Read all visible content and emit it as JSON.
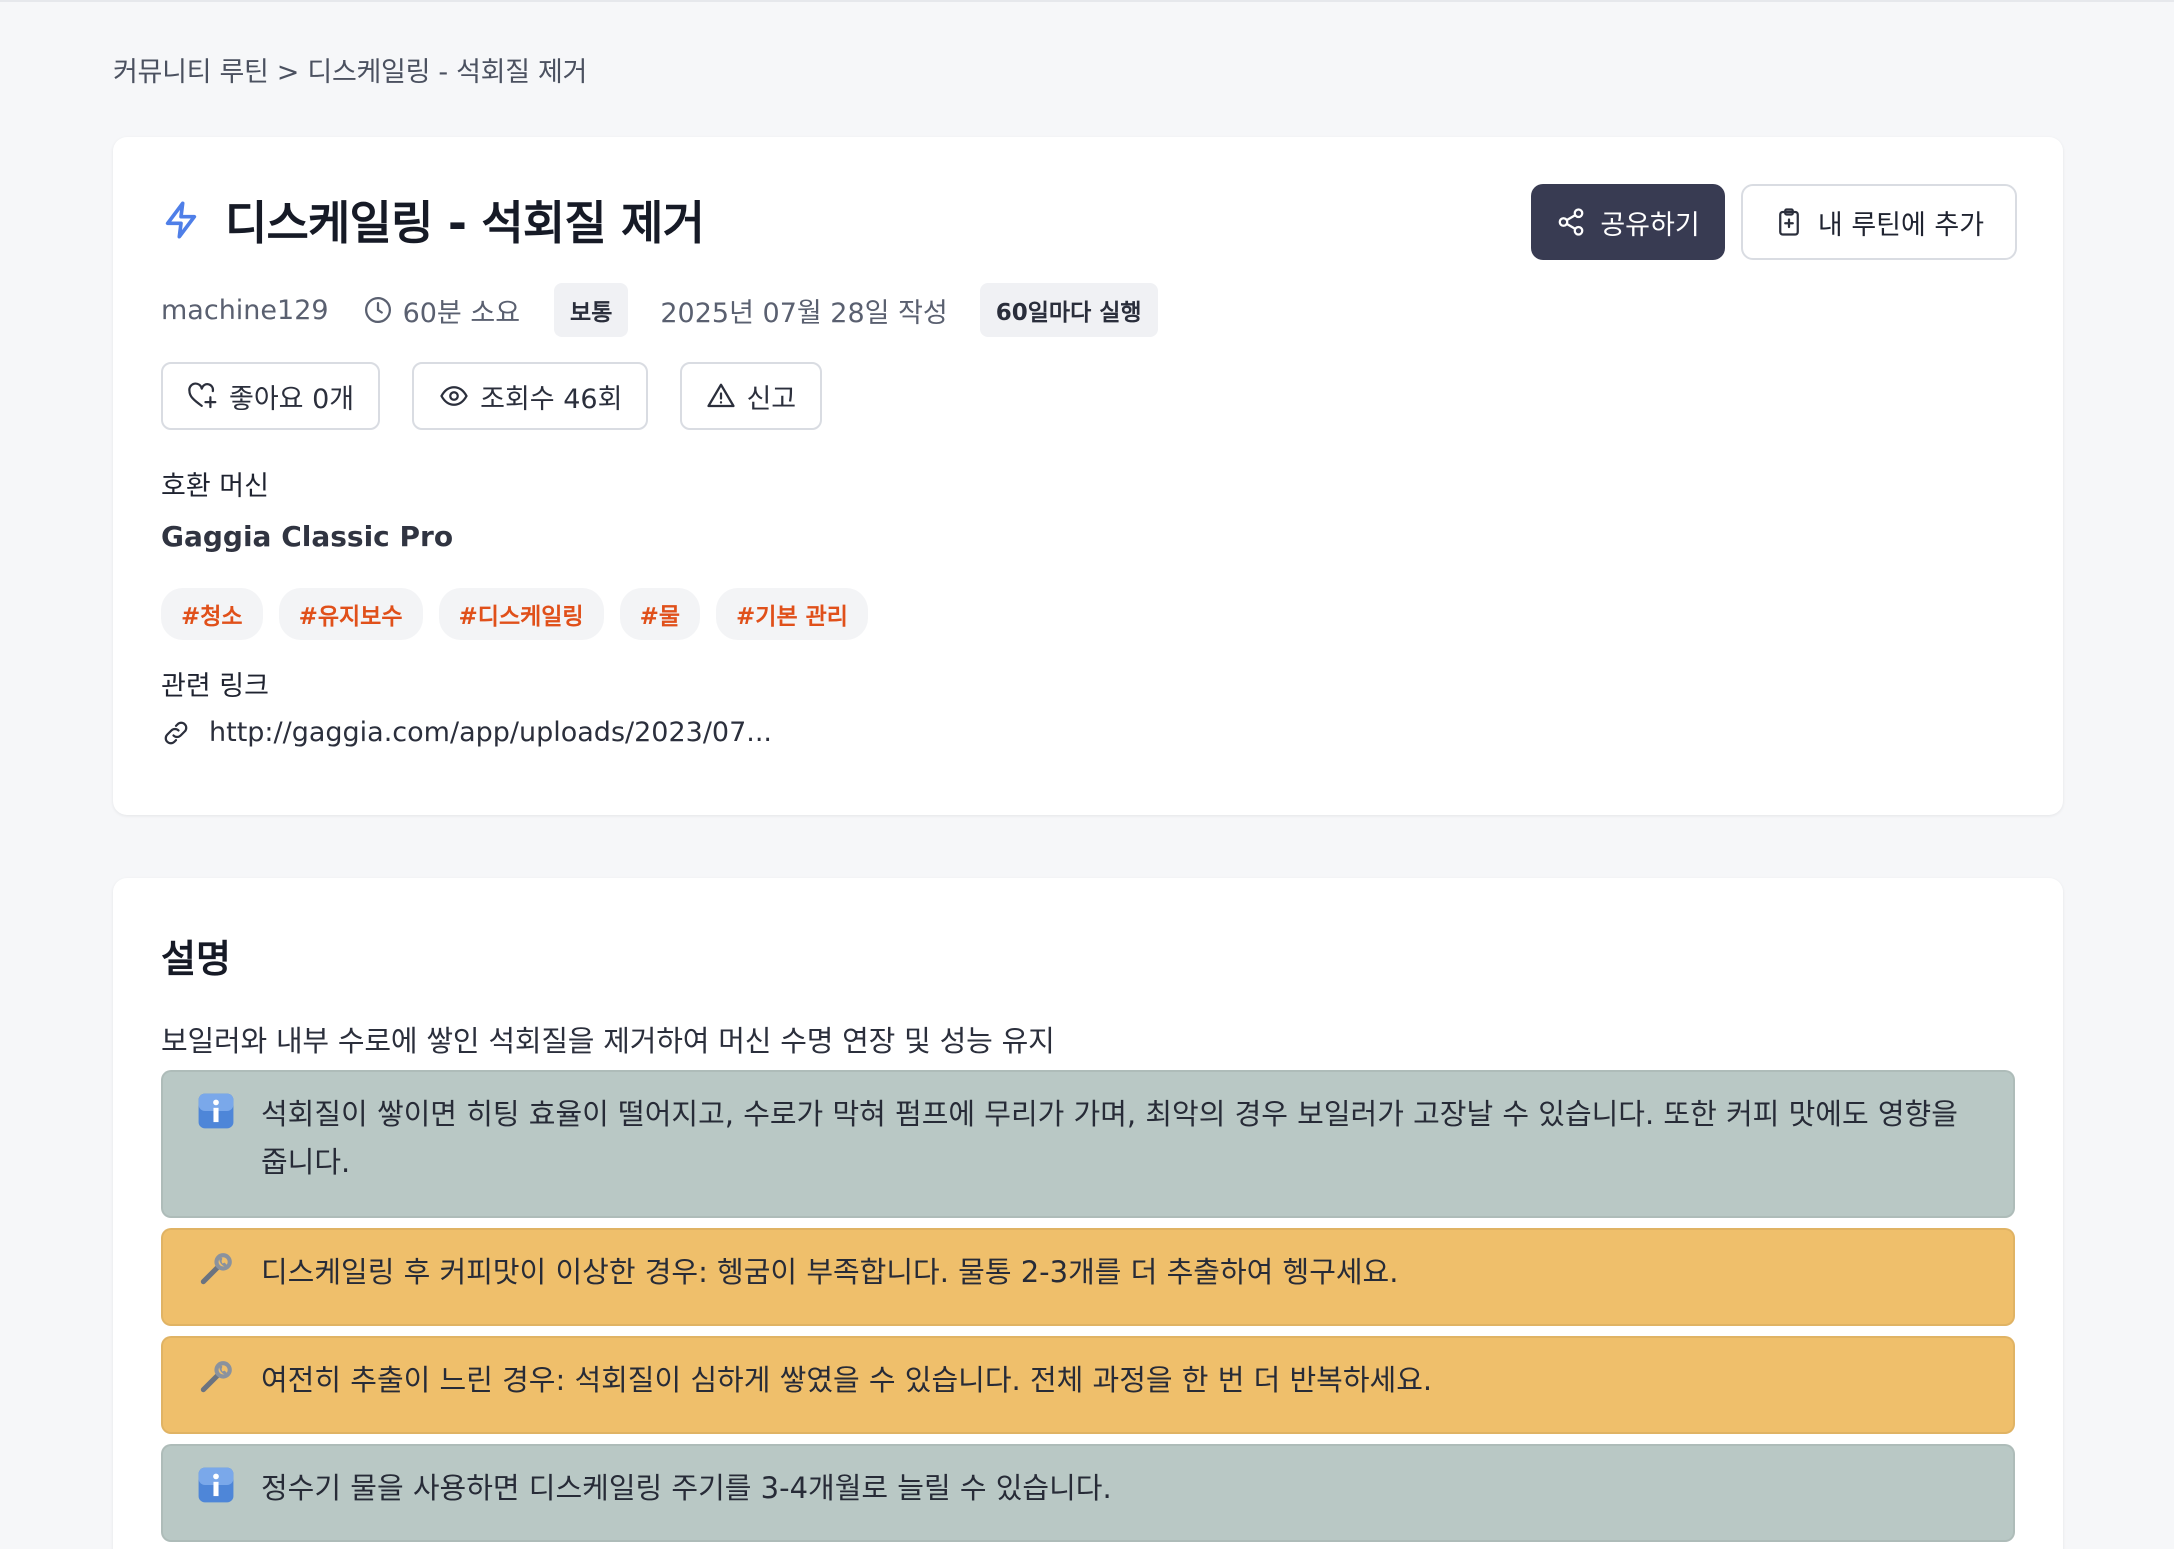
{
  "breadcrumb": "커뮤니티 루틴 > 디스케일링 - 석회질 제거",
  "routine": {
    "title": "디스케일링 - 석회질 제거",
    "share_label": "공유하기",
    "add_label": "내 루틴에 추가",
    "author": "machine129",
    "duration": "60분 소요",
    "difficulty": "보통",
    "created": "2025년 07월 28일 작성",
    "frequency": "60일마다 실행",
    "likes": "좋아요 0개",
    "views": "조회수 46회",
    "report": "신고",
    "machine_label": "호환 머신",
    "machine": "Gaggia Classic Pro",
    "tags": [
      "#청소",
      "#유지보수",
      "#디스케일링",
      "#물",
      "#기본 관리"
    ],
    "link_label": "관련 링크",
    "link": "http://gaggia.com/app/uploads/2023/07..."
  },
  "description": {
    "title": "설명",
    "text": "보일러와 내부 수로에 쌓인 석회질을 제거하여 머신 수명 연장 및 성능 유지",
    "notes": [
      {
        "type": "info",
        "icon": "info-icon",
        "text": "석회질이 쌓이면 히팅 효율이 떨어지고, 수로가 막혀 펌프에 무리가 가며, 최악의 경우 보일러가 고장날 수 있습니다. 또한 커피 맛에도 영향을 줍니다."
      },
      {
        "type": "warn",
        "icon": "wrench-icon",
        "text": "디스케일링 후 커피맛이 이상한 경우: 헹굼이 부족합니다. 물통 2-3개를 더 추출하여 헹구세요."
      },
      {
        "type": "warn",
        "icon": "wrench-icon",
        "text": "여전히 추출이 느린 경우: 석회질이 심하게 쌓였을 수 있습니다. 전체 과정을 한 번 더 반복하세요."
      },
      {
        "type": "info",
        "icon": "info-icon",
        "text": "정수기 물을 사용하면 디스케일링 주기를 3-4개월로 늘릴 수 있습니다."
      }
    ]
  },
  "colors": {
    "accent": "#383b52",
    "tag_text": "#e0501a",
    "info_bg": "#b9c8c5",
    "warn_bg": "#efbf6b"
  }
}
